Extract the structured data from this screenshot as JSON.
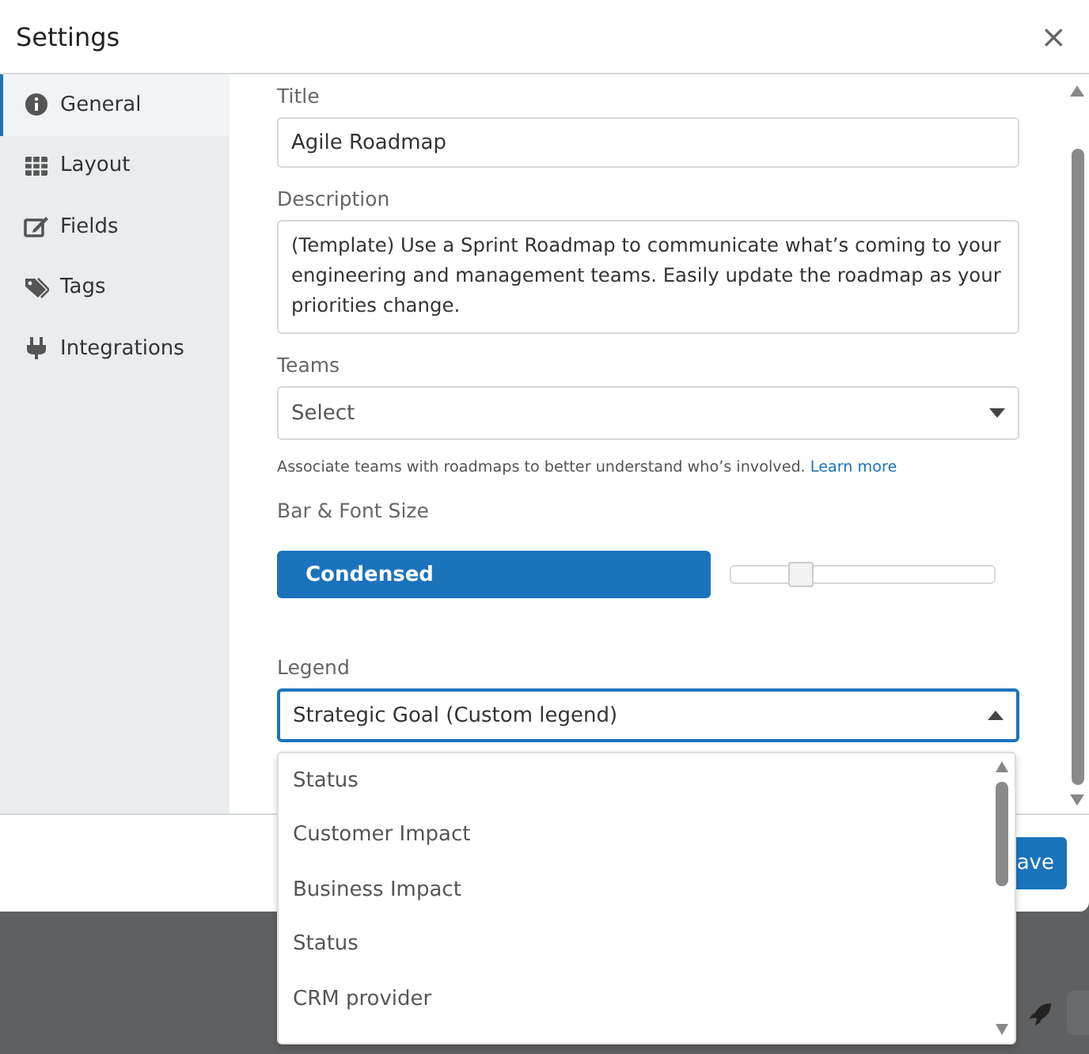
{
  "dialog": {
    "title": "Settings",
    "close": "×"
  },
  "sidebar": {
    "items": [
      {
        "label": "General",
        "selected": true
      },
      {
        "label": "Layout",
        "selected": false
      },
      {
        "label": "Fields",
        "selected": false
      },
      {
        "label": "Tags",
        "selected": false
      },
      {
        "label": "Integrations",
        "selected": false
      }
    ]
  },
  "form": {
    "title": {
      "label": "Title",
      "value": "Agile Roadmap"
    },
    "description": {
      "label": "Description",
      "value": "(Template) Use a Sprint Roadmap to communicate what’s coming to your engineering and management teams. Easily update the roadmap as your priorities change."
    },
    "teams": {
      "label": "Teams",
      "placeholder": "Select",
      "hint": "Associate teams with roadmaps to better understand who’s involved.",
      "link": "Learn more"
    },
    "size": {
      "label": "Bar & Font Size",
      "button": "Condensed",
      "level": 0.25
    },
    "legend": {
      "label": "Legend",
      "value": "Strategic Goal (Custom legend)",
      "expanded": true,
      "options": [
        "Status",
        "Customer Impact",
        "Business Impact",
        "Status",
        "CRM provider"
      ]
    }
  },
  "footer": {
    "button": "ave"
  }
}
